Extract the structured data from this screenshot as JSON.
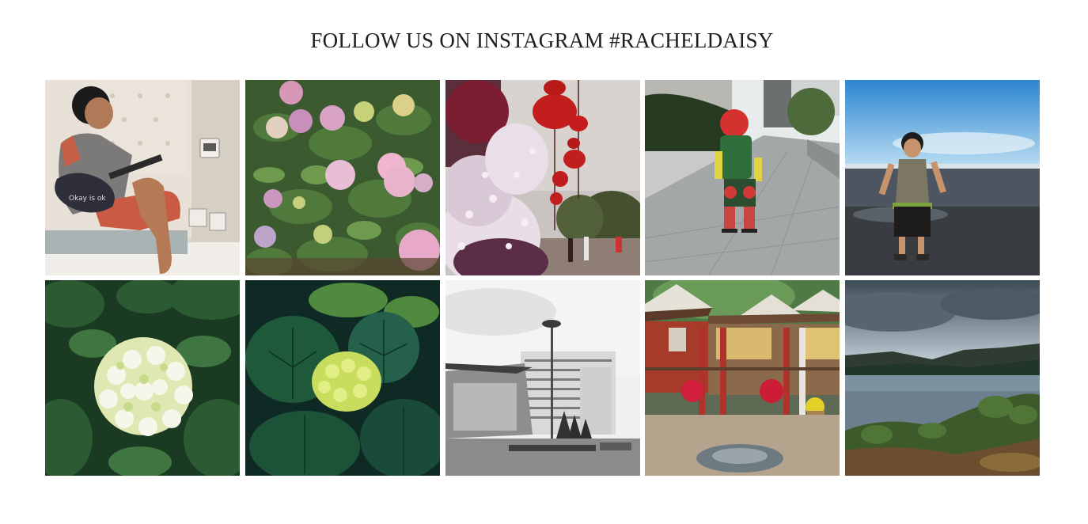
{
  "instagram": {
    "title": "FOLLOW US ON INSTAGRAM #RACHELDAISY",
    "photos": [
      {
        "subject": "boy-playing-ukulele-photo",
        "shirt_text": "Okay is ok"
      },
      {
        "subject": "pink-hydrangea-bush-photo"
      },
      {
        "subject": "red-lanterns-cherry-blossom-photo"
      },
      {
        "subject": "boy-rollerblading-photo"
      },
      {
        "subject": "boy-on-beach-photo"
      },
      {
        "subject": "white-hydrangea-photo"
      },
      {
        "subject": "green-hydrangea-bud-photo"
      },
      {
        "subject": "bw-building-street-photo"
      },
      {
        "subject": "wooden-house-flowers-photo"
      },
      {
        "subject": "mountain-lake-photo"
      }
    ]
  },
  "colors": {
    "title_text": "#1e1e1e",
    "background": "#ffffff"
  }
}
